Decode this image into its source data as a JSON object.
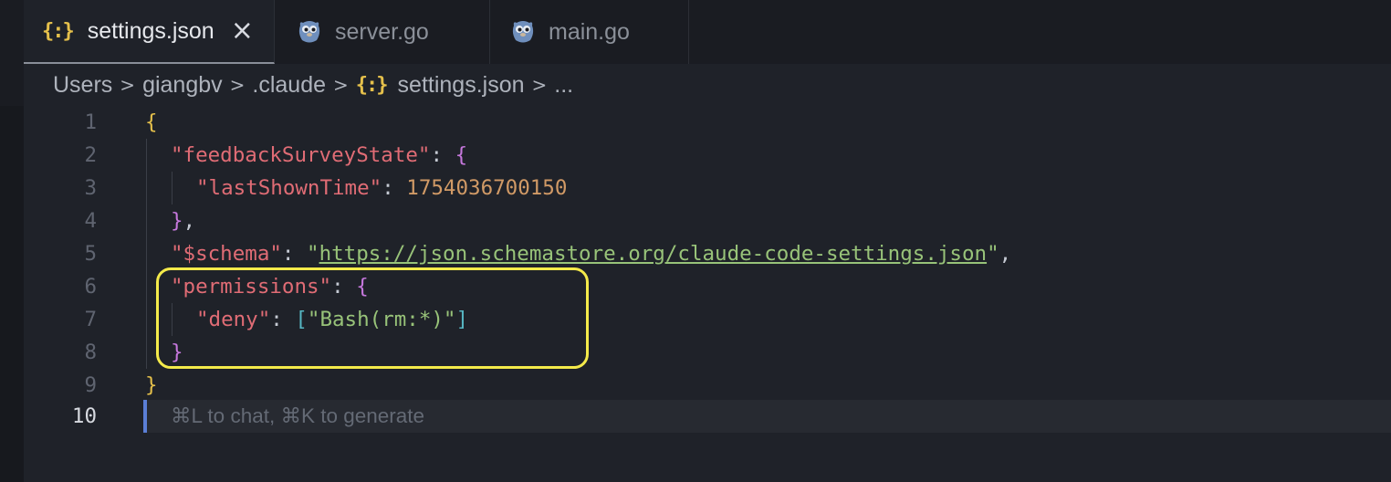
{
  "tabs": [
    {
      "label": "settings.json",
      "icon": "json-braces-icon",
      "active": true
    },
    {
      "label": "server.go",
      "icon": "gopher-icon",
      "active": false
    },
    {
      "label": "main.go",
      "icon": "gopher-icon",
      "active": false
    }
  ],
  "close_glyph": "×",
  "breadcrumb": {
    "items": [
      "Users",
      "giangbv",
      ".claude",
      "settings.json",
      "..."
    ],
    "separator": ">",
    "file_icon": "{:}"
  },
  "editor": {
    "line_numbers": [
      "1",
      "2",
      "3",
      "4",
      "5",
      "6",
      "7",
      "8",
      "9",
      "10"
    ],
    "current_line": "10",
    "code": {
      "l1_open": "{",
      "l2_key": "\"feedbackSurveyState\"",
      "l2_colon": ": ",
      "l2_brace": "{",
      "l3_key": "\"lastShownTime\"",
      "l3_colon": ": ",
      "l3_value": "1754036700150",
      "l4_brace": "}",
      "l4_comma": ",",
      "l5_key": "\"$schema\"",
      "l5_colon": ": ",
      "l5_q1": "\"",
      "l5_url": "https://json.schemastore.org/claude-code-settings.json",
      "l5_q2": "\"",
      "l5_comma": ",",
      "l6_key": "\"permissions\"",
      "l6_colon": ": ",
      "l6_brace": "{",
      "l7_key": "\"deny\"",
      "l7_colon": ": ",
      "l7_open": "[",
      "l7_value": "\"Bash(rm:*)\"",
      "l7_close": "]",
      "l8_brace": "}",
      "l9_close": "}"
    },
    "hint": "⌘L to chat, ⌘K to generate"
  },
  "colors": {
    "highlight": "#f4ea4a",
    "json_icon": "#e5c04b",
    "cursor": "#5b7fd6"
  }
}
